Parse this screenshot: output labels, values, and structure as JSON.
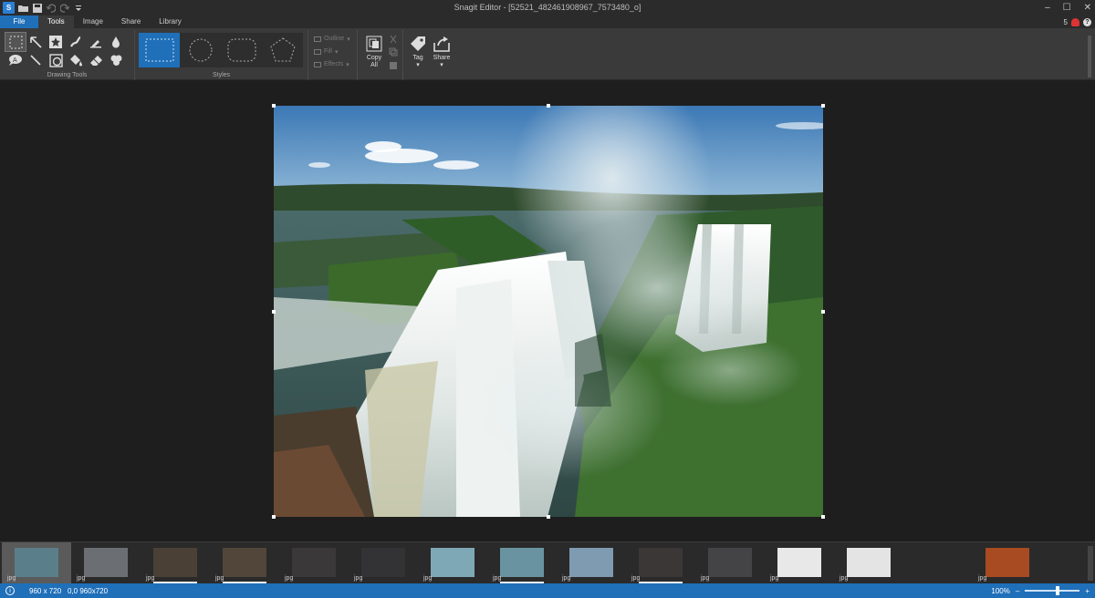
{
  "window": {
    "title": "Snagit Editor - [52521_482461908967_7573480_o]",
    "controls": {
      "minimize": "–",
      "maximize": "☐",
      "close": "✕"
    }
  },
  "menu": {
    "tabs": [
      {
        "label": "File"
      },
      {
        "label": "Tools"
      },
      {
        "label": "Image"
      },
      {
        "label": "Share"
      },
      {
        "label": "Library"
      }
    ],
    "active_tab": "Tools",
    "notification_count": "5"
  },
  "ribbon": {
    "drawing_tools_label": "Drawing Tools",
    "styles_label": "Styles",
    "outline_label": "Outline",
    "fill_label": "Fill",
    "effects_label": "Effects",
    "copy_all_label": "Copy All",
    "tag_label": "Tag",
    "share_label": "Share"
  },
  "tray": {
    "items": [
      {
        "ext": "jpg",
        "active": true,
        "color": "#5b7f8a"
      },
      {
        "ext": "jpg",
        "active": false,
        "color": "#6b6f74"
      },
      {
        "ext": "jpg",
        "active": false,
        "color": "#4a4036"
      },
      {
        "ext": "jpg",
        "active": false,
        "color": "#52463a"
      },
      {
        "ext": "jpg",
        "active": false,
        "color": "#3a3838"
      },
      {
        "ext": "jpg",
        "active": false,
        "color": "#333336"
      },
      {
        "ext": "jpg",
        "active": false,
        "color": "#7fa8b6"
      },
      {
        "ext": "jpg",
        "active": false,
        "color": "#6a93a2"
      },
      {
        "ext": "jpg",
        "active": false,
        "color": "#7e9bb2"
      },
      {
        "ext": "jpg",
        "active": false,
        "color": "#3b3736"
      },
      {
        "ext": "jpg",
        "active": false,
        "color": "#444446"
      },
      {
        "ext": "jpg",
        "active": false,
        "color": "#e8e8e8"
      },
      {
        "ext": "jpg",
        "active": false,
        "color": "#e4e4e4"
      },
      {
        "ext": "jpg",
        "active": false,
        "color": "#a84a22"
      }
    ]
  },
  "status": {
    "dimensions": "960 x 720",
    "coords": "0,0  960x720",
    "zoom": "100%",
    "zoom_out": "–",
    "zoom_in": "+"
  }
}
